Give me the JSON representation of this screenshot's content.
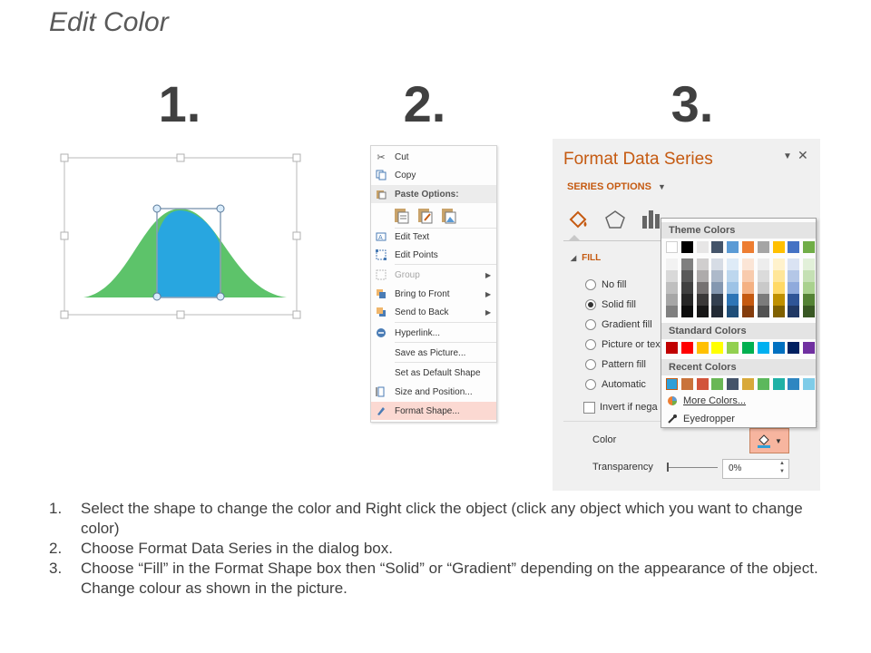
{
  "title": "Edit Color",
  "steps": [
    "1.",
    "2.",
    "3."
  ],
  "context_menu": {
    "items": [
      {
        "label": "Cut",
        "icon": "scissors-icon"
      },
      {
        "label": "Copy",
        "icon": "copy-icon"
      },
      {
        "label": "Paste Options:",
        "icon": "paste-icon"
      },
      {
        "label": "Edit Text",
        "icon": "edit-text-icon"
      },
      {
        "label": "Edit Points",
        "icon": "edit-points-icon"
      },
      {
        "label": "Group",
        "icon": "group-icon"
      },
      {
        "label": "Bring to Front",
        "icon": "bring-to-front-icon"
      },
      {
        "label": "Send to Back",
        "icon": "send-to-back-icon"
      },
      {
        "label": "Hyperlink...",
        "icon": "hyperlink-icon"
      },
      {
        "label": "Save as Picture...",
        "icon": ""
      },
      {
        "label": "Set as Default Shape",
        "icon": ""
      },
      {
        "label": "Size and Position...",
        "icon": "size-position-icon"
      },
      {
        "label": "Format Shape...",
        "icon": "format-shape-icon"
      }
    ]
  },
  "format_pane": {
    "title": "Format Data Series",
    "series_options": "SERIES OPTIONS",
    "fill_header": "FILL",
    "fill_options": [
      "No fill",
      "Solid fill",
      "Gradient fill",
      "Picture or tex",
      "Pattern fill",
      "Automatic"
    ],
    "selected_fill": "Solid fill",
    "invert_label": "Invert if nega",
    "color_label": "Color",
    "transparency_label": "Transparency",
    "transparency_value": "0%"
  },
  "color_popup": {
    "theme_header": "Theme Colors",
    "standard_header": "Standard Colors",
    "recent_header": "Recent Colors",
    "more_colors": "More Colors...",
    "eyedropper": "Eyedropper",
    "theme_colors": [
      "#ffffff",
      "#000000",
      "#e7e6e6",
      "#44546a",
      "#5b9bd5",
      "#ed7d31",
      "#a5a5a5",
      "#ffc000",
      "#4472c4",
      "#70ad47"
    ],
    "theme_shades": [
      [
        "#f2f2f2",
        "#d9d9d9",
        "#bfbfbf",
        "#a6a6a6",
        "#808080"
      ],
      [
        "#7f7f7f",
        "#595959",
        "#404040",
        "#262626",
        "#0d0d0d"
      ],
      [
        "#d0cece",
        "#aeabab",
        "#757171",
        "#3a3838",
        "#171616"
      ],
      [
        "#d6dce5",
        "#adb9ca",
        "#8497b0",
        "#333f50",
        "#222a35"
      ],
      [
        "#deebf7",
        "#bdd7ee",
        "#9dc3e6",
        "#2e75b6",
        "#1f4e79"
      ],
      [
        "#fbe5d6",
        "#f8cbad",
        "#f4b183",
        "#c55a11",
        "#843c0c"
      ],
      [
        "#ededed",
        "#dbdbdb",
        "#c9c9c9",
        "#7b7b7b",
        "#525252"
      ],
      [
        "#fff2cc",
        "#ffe699",
        "#ffd966",
        "#bf9000",
        "#7f6000"
      ],
      [
        "#dae3f3",
        "#b4c7e7",
        "#8faadc",
        "#2f5597",
        "#203864"
      ],
      [
        "#e2f0d9",
        "#c5e0b4",
        "#a9d18e",
        "#548235",
        "#385723"
      ]
    ],
    "standard_colors": [
      "#c00000",
      "#ff0000",
      "#ffc000",
      "#ffff00",
      "#92d050",
      "#00b050",
      "#00b0f0",
      "#0070c0",
      "#002060",
      "#7030a0"
    ],
    "recent_colors": [
      "#2e9fd8",
      "#c9733b",
      "#d2543b",
      "#6ab755",
      "#44546a",
      "#d8a93a",
      "#5cb85c",
      "#1fb1a6",
      "#2e86c1",
      "#7fcce8"
    ]
  },
  "instructions": [
    {
      "n": "1.",
      "text": "Select the shape to change the color and Right click the object (click any object which you want to change color)"
    },
    {
      "n": "2.",
      "text": "Choose Format Data Series in the dialog box."
    },
    {
      "n": "3.",
      "text": "Choose “Fill” in the Format Shape box then “Solid” or “Gradient” depending on the appearance of the object. Change colour as shown in the picture."
    }
  ]
}
